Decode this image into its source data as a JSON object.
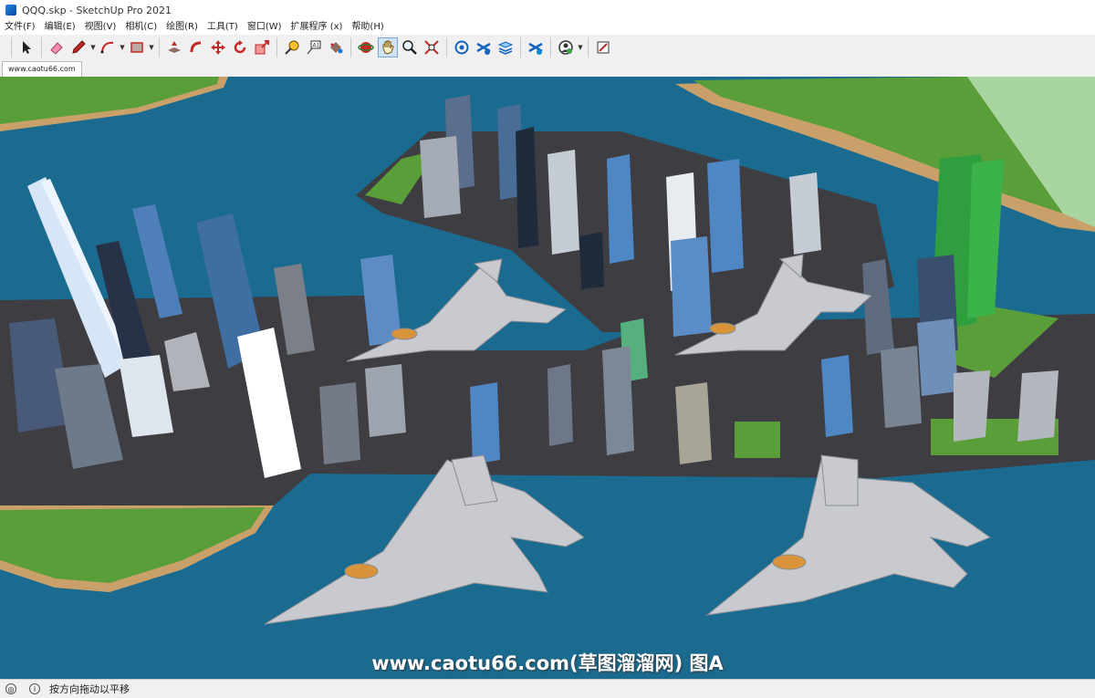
{
  "window": {
    "title": "QQQ.skp - SketchUp Pro 2021"
  },
  "menu": [
    "文件(F)",
    "编辑(E)",
    "视图(V)",
    "相机(C)",
    "绘图(R)",
    "工具(T)",
    "窗口(W)",
    "扩展程序 (x)",
    "帮助(H)"
  ],
  "toolbar": {
    "tools": [
      "select-icon",
      "eraser-icon",
      "pencil-icon",
      "arc-icon",
      "rectangle-icon",
      "push-pull-icon",
      "follow-me-icon",
      "move-icon",
      "rotate-icon",
      "scale-icon",
      "tape-measure-icon",
      "text-icon",
      "paint-bucket-icon",
      "orbit-icon",
      "pan-icon",
      "zoom-icon",
      "zoom-extents-icon",
      "warehouse-icon",
      "extension-icon",
      "components-icon",
      "layers-icon",
      "account-icon",
      "sign-in-icon"
    ],
    "active_tool": "pan-icon"
  },
  "tab": {
    "label": "www.caotu66.com"
  },
  "watermark": {
    "text": "www.caotu66.com(草图溜溜网) 图A"
  },
  "status": {
    "hint": "按方向拖动以平移"
  },
  "colors": {
    "water": "#1a6b8f",
    "grass": "#5a9e3a",
    "road": "#3d3d42",
    "sand": "#c9a06a"
  }
}
